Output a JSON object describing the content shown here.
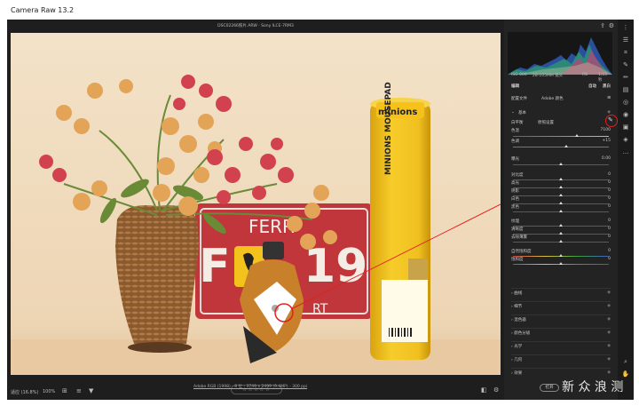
{
  "window": {
    "title": "Camera Raw 13.2"
  },
  "file": {
    "title": "DSC02266照片.ARW · Sony ILCE-7RM3"
  },
  "exif": {
    "iso": "ISO 800",
    "lens": "28-105MM 镜头",
    "aperture": "f/8",
    "shutter": "1/15 秒"
  },
  "panel": {
    "tab": "编辑",
    "auto": "自动",
    "bw": "黑白",
    "profile_label": "配置文件",
    "profile_value": "Adobe 颜色",
    "basic": "基本",
    "wb_label": "白平衡",
    "wb_value": "原照设置",
    "temp_label": "色温",
    "temp_value": "7100",
    "tint_label": "色调",
    "tint_value": "+15",
    "exposure_label": "曝光",
    "exposure_value": "0.00",
    "sliders": [
      "对比度",
      "高光",
      "阴影",
      "白色",
      "黑色",
      "纹理",
      "清晰度",
      "去除薄雾",
      "自然饱和度",
      "饱和度"
    ],
    "sliders_values": [
      "0",
      "0",
      "0",
      "0",
      "0",
      "0",
      "0",
      "0",
      "0",
      "0"
    ],
    "sections": [
      "曲线",
      "细节",
      "混色器",
      "颜色分级",
      "光学",
      "几何",
      "效果"
    ]
  },
  "bottom": {
    "zoom": "适应 (16.8%)",
    "pct": "100%",
    "rating": "☆☆☆☆☆",
    "info": "Adobe RGB (1998) - 8 位 - 3749 x 2499 (9.4MP) - 300 ppi",
    "open": "打开"
  },
  "photo": {
    "poster_text": "MINIONS MOUSEPAD",
    "brand": "minions",
    "plate": "FERR",
    "plate_num": "192",
    "plate_num2": "F1",
    "plate_rt": "RT"
  },
  "watermark": "新\n浪",
  "watermark_text": "新 众 浪 测",
  "colors": {
    "panel": "#232323",
    "app": "#1e1e1e",
    "wall": "#f0dcc0",
    "yellow": "#f2c524",
    "plate": "#c0363a",
    "annotation": "#e02020"
  }
}
